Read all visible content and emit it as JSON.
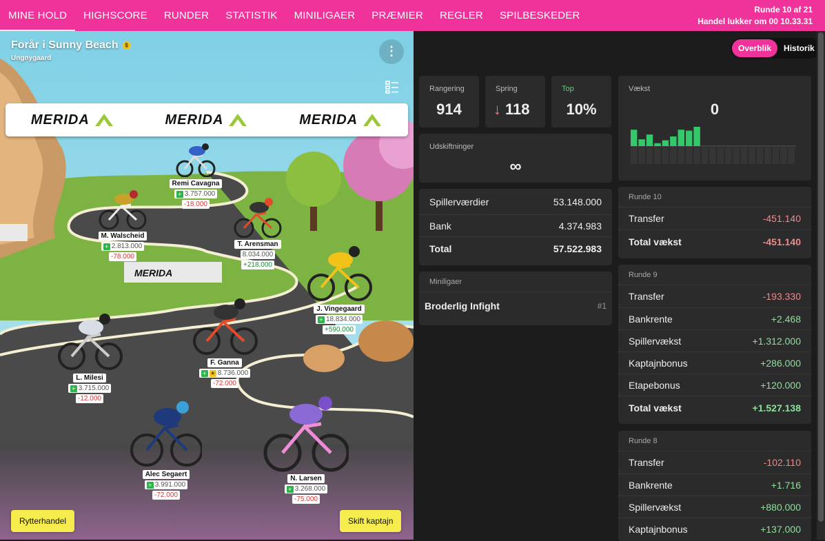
{
  "nav": {
    "items": [
      "MINE HOLD",
      "HIGHSCORE",
      "RUNDER",
      "STATISTIK",
      "MINILIGAER",
      "PRÆMIER",
      "REGLER",
      "SPILBESKEDER"
    ],
    "round": "Runde 10 af 21",
    "trade_closes": "Handel lukker om 00 10.33.31"
  },
  "team": {
    "name": "Forår i Sunny Beach",
    "subtitle": "Ungnygaard",
    "coin": "$",
    "banner_brand": "MERIDA",
    "riders": [
      {
        "name": "Remi Cavagna",
        "value": "3.757.000",
        "delta": "-18.000"
      },
      {
        "name": "M. Walscheid",
        "value": "2.813.000",
        "delta": "-78.000"
      },
      {
        "name": "T. Arensman",
        "value": "8.034.000",
        "delta": "+218.000"
      },
      {
        "name": "J. Vingegaard",
        "value": "18.834.000",
        "delta": "+590.000"
      },
      {
        "name": "L. Milesi",
        "value": "3.715.000",
        "delta": "-12.000"
      },
      {
        "name": "F. Ganna",
        "value": "8.736.000",
        "delta": "-72.000"
      },
      {
        "name": "Alec Segaert",
        "value": "3.991.000",
        "delta": "-72.000"
      },
      {
        "name": "N. Larsen",
        "value": "3.268.000",
        "delta": "-75.000"
      }
    ],
    "trade_button": "Rytterhandel",
    "captain_button": "Skift kaptajn"
  },
  "right": {
    "toggle": {
      "overview": "Overblik",
      "history": "Historik"
    },
    "stats": {
      "ranking_label": "Rangering",
      "ranking": "914",
      "jump_label": "Spring",
      "jump": "118",
      "top_label": "Top",
      "top": "10%",
      "growth_label": "Vækst",
      "growth": "0",
      "subs_label": "Udskiftninger",
      "subs": "∞"
    },
    "growth_chart": [
      0.85,
      0.35,
      0.6,
      0.15,
      0.3,
      0.5,
      0.85,
      0.8,
      1.0,
      0,
      0,
      0,
      0,
      0,
      0,
      0,
      0,
      0,
      0,
      0,
      0
    ],
    "values": {
      "players_label": "Spillerværdier",
      "players": "53.148.000",
      "bank_label": "Bank",
      "bank": "4.374.983",
      "total_label": "Total",
      "total": "57.522.983"
    },
    "minileagues": {
      "title": "Miniligaer",
      "name": "Broderlig Infight",
      "rank": "#1"
    },
    "rounds": [
      {
        "title": "Runde 10",
        "rows": [
          {
            "label": "Transfer",
            "value": "-451.140"
          }
        ],
        "total_label": "Total vækst",
        "total": "-451.140"
      },
      {
        "title": "Runde 9",
        "rows": [
          {
            "label": "Transfer",
            "value": "-193.330"
          },
          {
            "label": "Bankrente",
            "value": "+2.468"
          },
          {
            "label": "Spillervækst",
            "value": "+1.312.000"
          },
          {
            "label": "Kaptajnbonus",
            "value": "+286.000"
          },
          {
            "label": "Etapebonus",
            "value": "+120.000"
          }
        ],
        "total_label": "Total vækst",
        "total": "+1.527.138"
      },
      {
        "title": "Runde 8",
        "rows": [
          {
            "label": "Transfer",
            "value": "-102.110"
          },
          {
            "label": "Bankrente",
            "value": "+1.716"
          },
          {
            "label": "Spillervækst",
            "value": "+880.000"
          },
          {
            "label": "Kaptajnbonus",
            "value": "+137.000"
          }
        ]
      }
    ]
  }
}
